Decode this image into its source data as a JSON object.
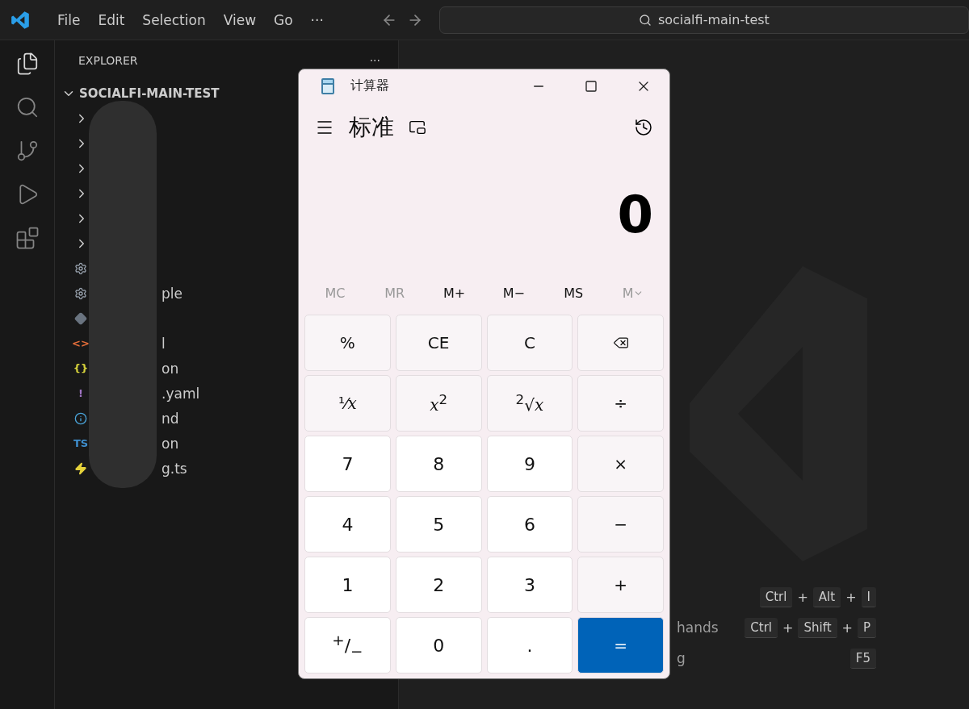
{
  "menu": [
    "File",
    "Edit",
    "Selection",
    "View",
    "Go",
    "···"
  ],
  "search": {
    "value": "socialfi-main-test"
  },
  "activity_bar": [
    {
      "kind": "files",
      "selected": true
    },
    {
      "kind": "search",
      "selected": false
    },
    {
      "kind": "source-control",
      "selected": false
    },
    {
      "kind": "run-debug",
      "selected": false
    },
    {
      "kind": "extensions",
      "selected": false
    }
  ],
  "sidebar": {
    "title": "EXPLORER",
    "more": "···",
    "root": {
      "name": "SOCIALFI-MAIN-TEST",
      "expanded": true,
      "children": [
        {
          "kind": "folder",
          "expanded": false
        },
        {
          "kind": "folder",
          "expanded": false
        },
        {
          "kind": "folder",
          "expanded": false
        },
        {
          "kind": "folder",
          "expanded": false
        },
        {
          "kind": "folder",
          "expanded": false
        },
        {
          "kind": "folder",
          "expanded": false
        },
        {
          "kind": "settings"
        },
        {
          "kind": "settings",
          "name": "ple"
        },
        {
          "kind": "git"
        },
        {
          "kind": "html",
          "icon": "<>",
          "name": "l"
        },
        {
          "kind": "json",
          "icon": "{}",
          "name": "on"
        },
        {
          "kind": "yaml",
          "icon": "!",
          "name": ".yaml"
        },
        {
          "kind": "info",
          "name": "nd"
        },
        {
          "kind": "ts",
          "icon": "TS",
          "name": "on"
        },
        {
          "kind": "lightning",
          "name": "g.ts"
        }
      ]
    }
  },
  "calculator": {
    "title": "计算器",
    "mode": "标准",
    "display": "0",
    "memory": [
      {
        "label": "MC",
        "disabled": true
      },
      {
        "label": "MR",
        "disabled": true
      },
      {
        "label": "M+",
        "disabled": false
      },
      {
        "label": "M−",
        "disabled": false
      },
      {
        "label": "MS",
        "disabled": false
      },
      {
        "label": "M",
        "disabled": true,
        "kind": "dropdown"
      }
    ],
    "buttons": [
      {
        "kind": "function",
        "label": "%"
      },
      {
        "kind": "function",
        "label": "CE"
      },
      {
        "kind": "function",
        "label": "C"
      },
      {
        "kind": "backspace"
      },
      {
        "kind": "function",
        "label": "¹⁄*x*"
      },
      {
        "kind": "function",
        "label": "*x*$^{2}$"
      },
      {
        "kind": "function",
        "label": "$^{2}$√*x*"
      },
      {
        "kind": "operator",
        "label": "÷"
      },
      {
        "kind": "number",
        "label": "7"
      },
      {
        "kind": "number",
        "label": "8"
      },
      {
        "kind": "number",
        "label": "9"
      },
      {
        "kind": "operator",
        "label": "×"
      },
      {
        "kind": "number",
        "label": "4"
      },
      {
        "kind": "number",
        "label": "5"
      },
      {
        "kind": "number",
        "label": "6"
      },
      {
        "kind": "operator",
        "label": "−"
      },
      {
        "kind": "number",
        "label": "1"
      },
      {
        "kind": "number",
        "label": "2"
      },
      {
        "kind": "number",
        "label": "3"
      },
      {
        "kind": "operator",
        "label": "+"
      },
      {
        "kind": "number",
        "label": "$^{+}$/$_{−}$"
      },
      {
        "kind": "number",
        "label": "0"
      },
      {
        "kind": "number",
        "label": "."
      },
      {
        "kind": "equals",
        "label": "="
      }
    ]
  },
  "shortcuts": [
    {
      "keys": [
        {
          "kind": "key",
          "text": "Ctrl"
        },
        {
          "kind": "plus",
          "text": "+"
        },
        {
          "kind": "key",
          "text": "Alt"
        },
        {
          "kind": "plus",
          "text": "+"
        },
        {
          "kind": "key",
          "text": "I"
        }
      ]
    },
    {
      "label": "hands",
      "keys": [
        {
          "kind": "key",
          "text": "Ctrl"
        },
        {
          "kind": "plus",
          "text": "+"
        },
        {
          "kind": "key",
          "text": "Shift"
        },
        {
          "kind": "plus",
          "text": "+"
        },
        {
          "kind": "key",
          "text": "P"
        }
      ]
    },
    {
      "label": "g",
      "keys": [
        {
          "kind": "key",
          "text": "F5"
        }
      ]
    }
  ]
}
